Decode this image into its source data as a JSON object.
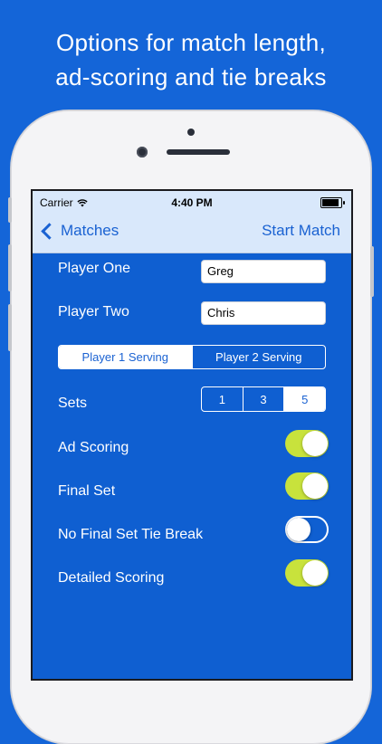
{
  "headline": {
    "line1": "Options for match length,",
    "line2": "ad-scoring and tie breaks"
  },
  "status_bar": {
    "carrier": "Carrier",
    "time": "4:40 PM"
  },
  "nav": {
    "back_label": "Matches",
    "action_label": "Start Match"
  },
  "form": {
    "player_one_label": "Player One",
    "player_one_value": "Greg",
    "player_two_label": "Player Two",
    "player_two_value": "Chris",
    "serving_options": [
      "Player 1 Serving",
      "Player 2 Serving"
    ],
    "serving_selected": "Player 1 Serving",
    "sets_label": "Sets",
    "sets_options": [
      "1",
      "3",
      "5"
    ],
    "sets_selected": "5",
    "toggles": [
      {
        "label": "Ad Scoring",
        "on": true
      },
      {
        "label": "Final Set",
        "on": true
      },
      {
        "label": "No Final Set Tie Break",
        "on": false
      },
      {
        "label": "Detailed Scoring",
        "on": true
      }
    ]
  },
  "colors": {
    "background": "#1465d8",
    "screen_bg": "#0f5fd1",
    "accent": "#1a62d2",
    "toggle_on": "#c8e23c"
  }
}
